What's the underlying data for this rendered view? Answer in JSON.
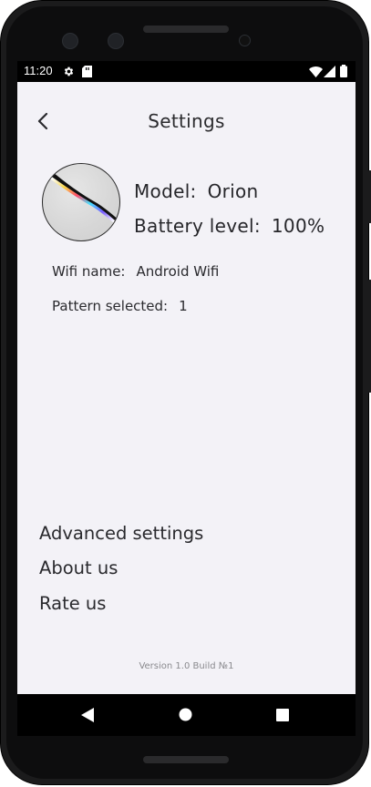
{
  "status_bar": {
    "time": "11:20",
    "icons": [
      "settings-gear-icon",
      "sd-card-icon",
      "wifi-icon",
      "cell-signal-icon",
      "battery-icon"
    ]
  },
  "header": {
    "title": "Settings",
    "back_icon": "chevron-left-icon"
  },
  "device": {
    "model_label": "Model:",
    "model_value": "Orion",
    "battery_label": "Battery level:",
    "battery_value": "100%",
    "wifi_label": "Wifi name:",
    "wifi_value": "Android Wifi",
    "pattern_label": "Pattern selected:",
    "pattern_value": "1"
  },
  "menu": {
    "items": [
      {
        "label": "Advanced settings"
      },
      {
        "label": "About us"
      },
      {
        "label": "Rate us"
      }
    ]
  },
  "footer": {
    "version": "Version 1.0 Build №1"
  },
  "nav_bar": {
    "buttons": [
      "back-triangle-icon",
      "home-circle-icon",
      "recents-square-icon"
    ]
  },
  "colors": {
    "screen_bg": "#f3f2f7",
    "text": "#2a2a2e",
    "phone_frame": "#1b1b1c"
  }
}
